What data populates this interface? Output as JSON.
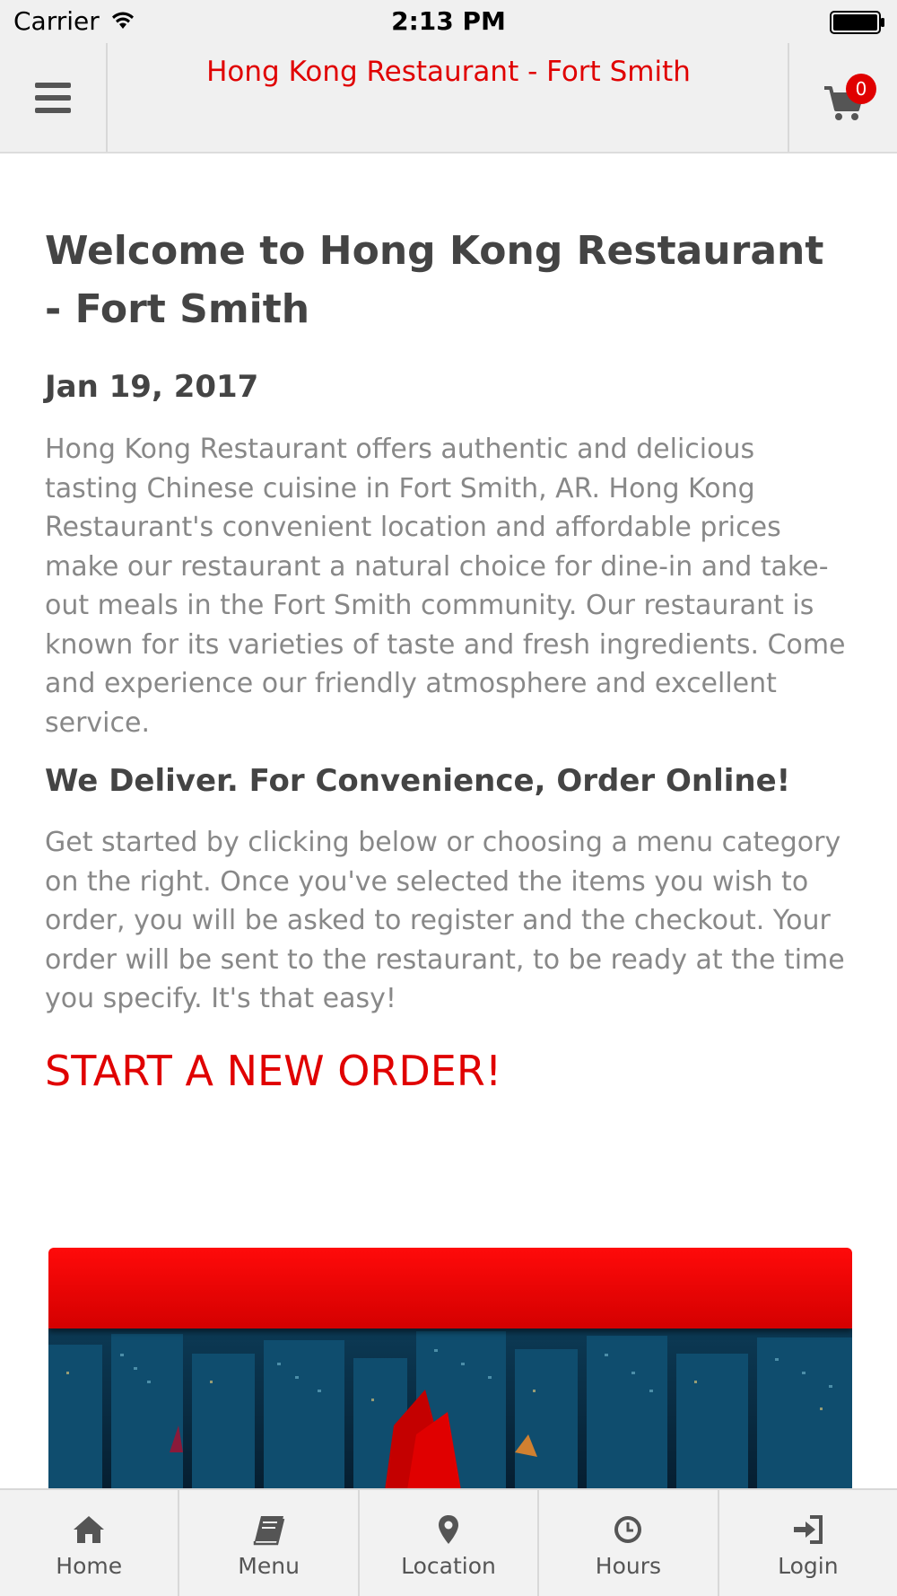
{
  "status_bar": {
    "carrier": "Carrier",
    "time": "2:13 PM"
  },
  "header": {
    "title": "Hong Kong Restaurant - Fort Smith",
    "cart_count": "0"
  },
  "content": {
    "title": "Welcome to Hong Kong Restaurant - Fort Smith",
    "date": "Jan 19, 2017",
    "intro": "Hong Kong Restaurant offers authentic and delicious tasting Chinese cuisine in Fort Smith, AR. Hong Kong Restaurant's convenient location and affordable prices make our restaurant a natural choice for dine-in and take-out meals in the Fort Smith community. Our restaurant is known for its varieties of taste and fresh ingredients. Come and experience our friendly atmosphere and excellent service.",
    "subheading": "We Deliver. For Convenience, Order Online!",
    "howto": "Get started by clicking below or choosing a menu category on the right. Once you've selected the items you wish to order, you will be asked to register and the checkout. Your order will be sent to the restaurant, to be ready at the time you specify. It's that easy!",
    "cta": "START A NEW ORDER!"
  },
  "tabs": [
    {
      "label": "Home",
      "icon": "home-icon"
    },
    {
      "label": "Menu",
      "icon": "book-icon"
    },
    {
      "label": "Location",
      "icon": "map-marker-icon"
    },
    {
      "label": "Hours",
      "icon": "clock-icon"
    },
    {
      "label": "Login",
      "icon": "sign-in-icon"
    }
  ],
  "colors": {
    "accent": "#e00000",
    "bar_bg": "#f0f0f0",
    "heading": "#444444",
    "body_text": "#888888"
  }
}
